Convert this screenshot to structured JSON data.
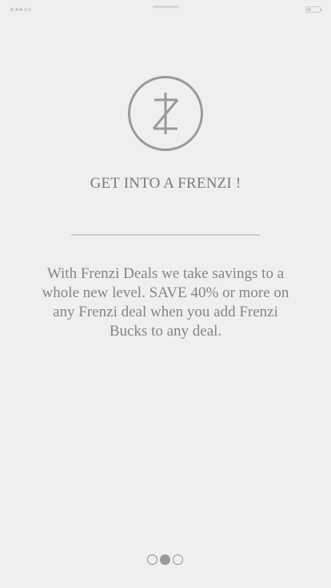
{
  "status_bar": {
    "signal_dots": [
      "on",
      "on",
      "on",
      "off",
      "off"
    ],
    "battery_icon": "battery-low-icon"
  },
  "logo": {
    "icon": "frenzi-z-logo-icon"
  },
  "onboarding": {
    "title": "GET INTO A FRENZI !",
    "body": "With Frenzi Deals we take savings to a whole new level. SAVE 40% or more on any Frenzi deal when you add Frenzi Bucks to any deal."
  },
  "pager": {
    "pages": 3,
    "active_page": 2
  },
  "colors": {
    "background": "#efefef",
    "text": "#858585",
    "accent": "#9a9a9a"
  }
}
